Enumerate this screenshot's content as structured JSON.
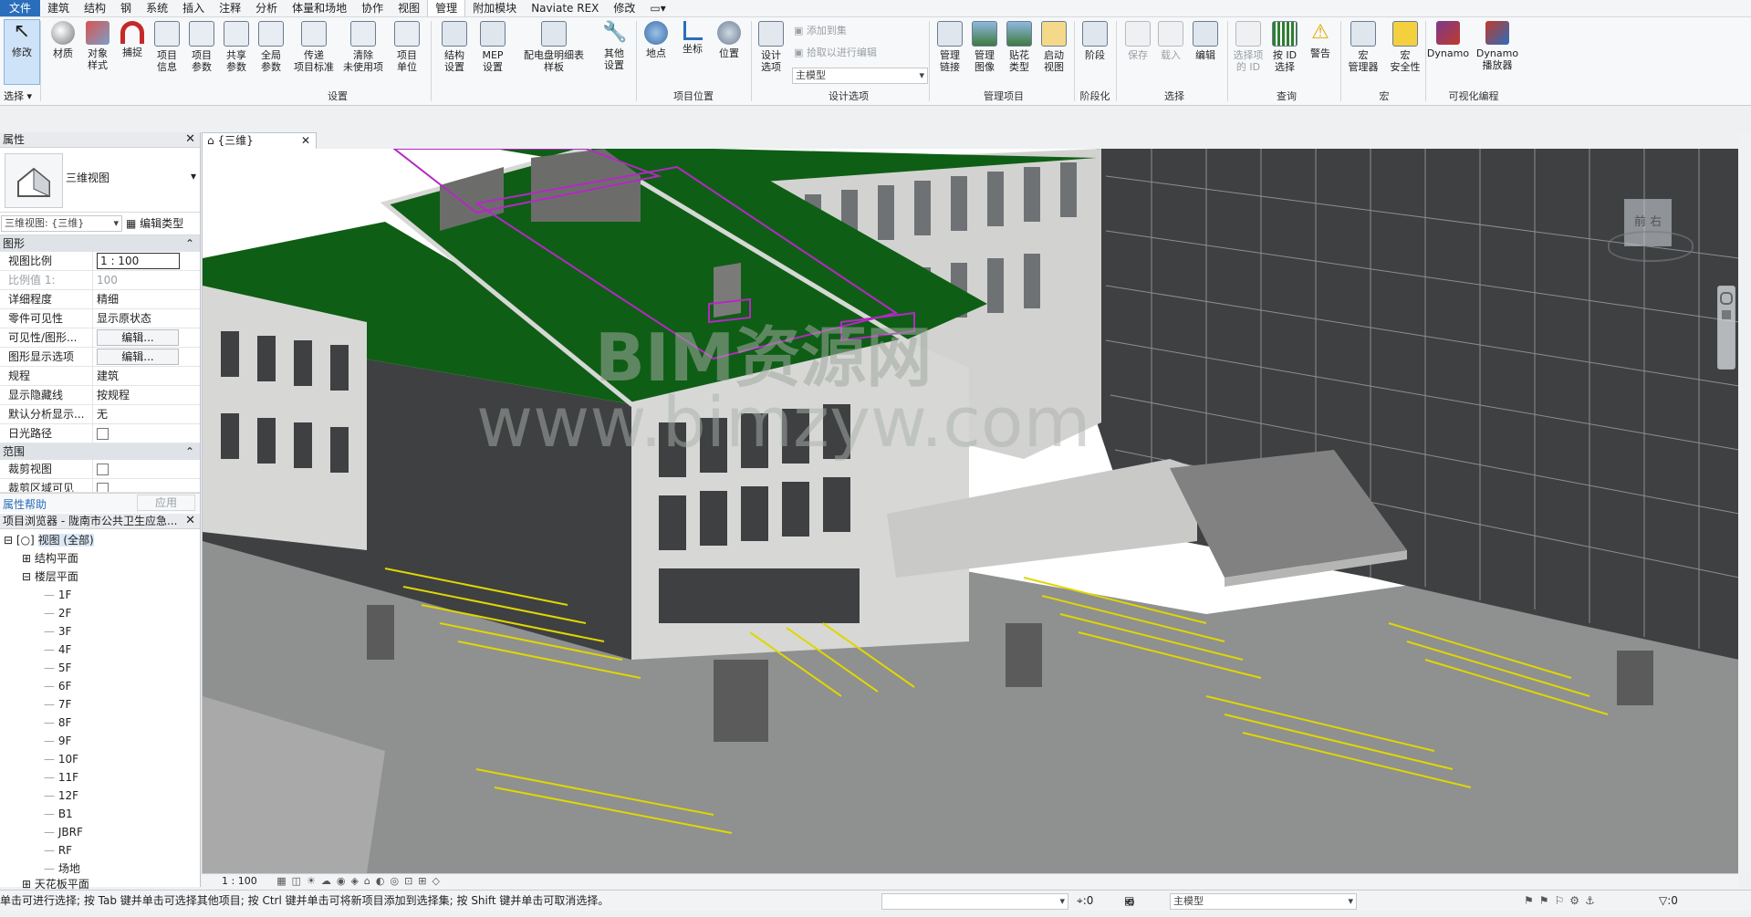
{
  "menu": [
    "文件",
    "建筑",
    "结构",
    "钢",
    "系统",
    "插入",
    "注释",
    "分析",
    "体量和场地",
    "协作",
    "视图",
    "管理",
    "附加模块",
    "Naviate REX",
    "修改"
  ],
  "ribbon": {
    "select_label": "选择",
    "tools": [
      {
        "label": "修改",
        "icon": "cursor-icon"
      },
      {
        "label": "材质",
        "icon": "material-sphere-icon"
      },
      {
        "label": "对象\n样式",
        "icon": "object-styles-icon"
      },
      {
        "label": "捕捉",
        "icon": "magnet-icon"
      },
      {
        "label": "项目\n信息",
        "icon": "project-info-icon"
      },
      {
        "label": "项目\n参数",
        "icon": "project-parameters-icon"
      },
      {
        "label": "共享\n参数",
        "icon": "shared-parameters-icon"
      },
      {
        "label": "全局\n参数",
        "icon": "global-parameters-icon"
      },
      {
        "label": "传递\n项目标准",
        "icon": "transfer-standards-icon"
      },
      {
        "label": "清除\n未使用项",
        "icon": "purge-icon"
      },
      {
        "label": "项目\n单位",
        "icon": "project-units-icon"
      },
      {
        "label": "结构\n设置",
        "icon": "structural-settings-icon"
      },
      {
        "label": "MEP\n设置",
        "icon": "mep-settings-icon"
      },
      {
        "label": "配电盘明细表\n样板",
        "icon": "panel-schedule-icon"
      },
      {
        "label": "其他\n设置",
        "icon": "wrench-icon"
      },
      {
        "label": "地点",
        "icon": "globe-icon"
      },
      {
        "label": "坐标",
        "icon": "coordinates-icon"
      },
      {
        "label": "位置",
        "icon": "position-icon"
      },
      {
        "label": "设计\n选项",
        "icon": "design-options-icon"
      },
      {
        "label": "管理\n链接",
        "icon": "manage-links-icon"
      },
      {
        "label": "管理\n图像",
        "icon": "manage-images-icon"
      },
      {
        "label": "贴花\n类型",
        "icon": "decal-icon"
      },
      {
        "label": "启动\n视图",
        "icon": "starting-view-icon"
      },
      {
        "label": "阶段",
        "icon": "phases-icon"
      },
      {
        "label": "保存",
        "icon": "save-selection-icon"
      },
      {
        "label": "载入",
        "icon": "load-selection-icon"
      },
      {
        "label": "编辑",
        "icon": "edit-selection-icon"
      },
      {
        "label": "选择项\n的 ID",
        "icon": "ids-of-selection-icon"
      },
      {
        "label": "按 ID\n选择",
        "icon": "select-by-id-icon"
      },
      {
        "label": "警告",
        "icon": "warning-icon"
      },
      {
        "label": "宏\n管理器",
        "icon": "macro-manager-icon"
      },
      {
        "label": "宏\n安全性",
        "icon": "macro-security-icon"
      },
      {
        "label": "Dynamo",
        "icon": "dynamo-icon"
      },
      {
        "label": "Dynamo\n播放器",
        "icon": "dynamo-player-icon"
      }
    ],
    "panels": [
      "设置",
      "项目位置",
      "设计选项",
      "管理项目",
      "阶段化",
      "选择",
      "查询",
      "宏",
      "可视化编程"
    ],
    "design_options": {
      "add_to_set": "添加到集",
      "pick_to_edit": "拾取以进行编辑",
      "main_model": "主模型"
    }
  },
  "properties": {
    "title": "属性",
    "type_name": "三维视图",
    "instance_selector": "三维视图: {三维}",
    "edit_type": "编辑类型",
    "section_graphics": "图形",
    "rows": [
      {
        "k": "视图比例",
        "v": "1 : 100"
      },
      {
        "k": "比例值 1:",
        "v": "100"
      },
      {
        "k": "详细程度",
        "v": "精细"
      },
      {
        "k": "零件可见性",
        "v": "显示原状态"
      },
      {
        "k": "可见性/图形...",
        "v": "编辑..."
      },
      {
        "k": "图形显示选项",
        "v": "编辑..."
      },
      {
        "k": "规程",
        "v": "建筑"
      },
      {
        "k": "显示隐藏线",
        "v": "按规程"
      },
      {
        "k": "默认分析显示...",
        "v": "无"
      },
      {
        "k": "日光路径",
        "v": ""
      }
    ],
    "section_extents": "范围",
    "extent_rows": [
      {
        "k": "裁剪视图",
        "v": ""
      },
      {
        "k": "裁剪区域可见",
        "v": ""
      }
    ],
    "help": "属性帮助",
    "apply": "应用"
  },
  "browser": {
    "title": "项目浏览器 - 陇南市公共卫生应急...",
    "root": "视图 (全部)",
    "groups": [
      "结构平面",
      "楼层平面"
    ],
    "levels": [
      "1F",
      "2F",
      "3F",
      "4F",
      "5F",
      "6F",
      "7F",
      "8F",
      "9F",
      "10F",
      "11F",
      "12F",
      "B1",
      "JBRF",
      "RF",
      "场地"
    ],
    "last_group": "天花板平面"
  },
  "view_tab": "{三维}",
  "view_scale": "1 : 100",
  "viewcube": {
    "front": "前",
    "right": "右"
  },
  "watermark": {
    "line1": "BIM资源网",
    "line2": "www.bimzyw.com"
  },
  "status": {
    "hint": "单击可进行选择; 按 Tab 键并单击可选择其他项目; 按 Ctrl 键并单击可将新项目添加到选择集; 按 Shift 键并单击可取消选择。",
    "count_a": ":0",
    "model": "主模型",
    "count_b": ":0"
  },
  "colors": {
    "roof": "#0f5e16",
    "wall_light": "#d7d8d6",
    "wall_dark": "#3e4042",
    "ground": "#8f9090",
    "accent": "#2a6ebb",
    "parking_line": "#e0d600",
    "magenta": "#b429c3"
  }
}
